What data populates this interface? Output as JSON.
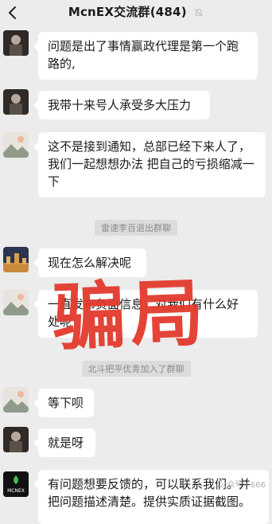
{
  "header": {
    "title": "McnEX交流群(484)"
  },
  "messages": [
    {
      "text": "问题是出了事情赢政代理是第一个跑路的,"
    },
    {
      "text": "我带十来号人承受多大压力"
    },
    {
      "text": "这不是接到通知，总部已经下来人了，我们一起想想办法 把自己的亏损缩减一下"
    },
    {
      "text": "现在怎么解决呢"
    },
    {
      "text": "一直发布负面信息，对我们有什么好处呢"
    },
    {
      "text": "等下呗"
    },
    {
      "text": "就是呀"
    },
    {
      "text": "有问题想要反馈的，可以联系我们。并把问题描述清楚。提供实质证据截图。"
    }
  ],
  "system_notices": [
    {
      "text": "雷速李百退出群聊"
    },
    {
      "text": "北斗把平优青加入了群聊"
    }
  ],
  "overlay": {
    "stamp_text": "骗局",
    "watermark_text": "公众号 · 666"
  },
  "avatars": {
    "official_logo_text": "MCNEX"
  }
}
